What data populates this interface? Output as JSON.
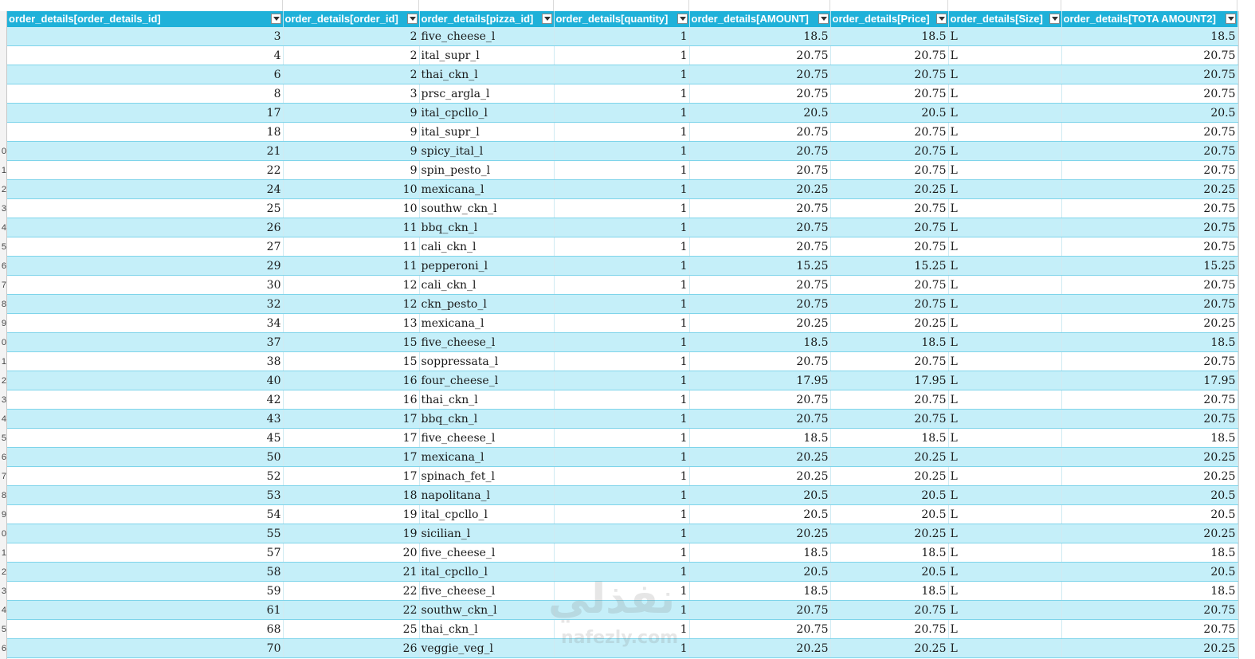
{
  "table": {
    "columns": [
      {
        "key": "order_details_id",
        "label": "order_details[order_details_id]",
        "align": "right"
      },
      {
        "key": "order_id",
        "label": "order_details[order_id]",
        "align": "right"
      },
      {
        "key": "pizza_id",
        "label": "order_details[pizza_id]",
        "align": "left"
      },
      {
        "key": "quantity",
        "label": "order_details[quantity]",
        "align": "right"
      },
      {
        "key": "amount",
        "label": "order_details[AMOUNT]",
        "align": "right"
      },
      {
        "key": "price",
        "label": "order_details[Price]",
        "align": "right"
      },
      {
        "key": "size",
        "label": "order_details[Size]",
        "align": "left"
      },
      {
        "key": "total_amount2",
        "label": "order_details[TOTA AMOUNT2]",
        "align": "right"
      }
    ],
    "rows": [
      [
        "3",
        "2",
        "five_cheese_l",
        "1",
        "18.5",
        "18.5",
        "L",
        "18.5"
      ],
      [
        "4",
        "2",
        "ital_supr_l",
        "1",
        "20.75",
        "20.75",
        "L",
        "20.75"
      ],
      [
        "6",
        "2",
        "thai_ckn_l",
        "1",
        "20.75",
        "20.75",
        "L",
        "20.75"
      ],
      [
        "8",
        "3",
        "prsc_argla_l",
        "1",
        "20.75",
        "20.75",
        "L",
        "20.75"
      ],
      [
        "17",
        "9",
        "ital_cpcllo_l",
        "1",
        "20.5",
        "20.5",
        "L",
        "20.5"
      ],
      [
        "18",
        "9",
        "ital_supr_l",
        "1",
        "20.75",
        "20.75",
        "L",
        "20.75"
      ],
      [
        "21",
        "9",
        "spicy_ital_l",
        "1",
        "20.75",
        "20.75",
        "L",
        "20.75"
      ],
      [
        "22",
        "9",
        "spin_pesto_l",
        "1",
        "20.75",
        "20.75",
        "L",
        "20.75"
      ],
      [
        "24",
        "10",
        "mexicana_l",
        "1",
        "20.25",
        "20.25",
        "L",
        "20.25"
      ],
      [
        "25",
        "10",
        "southw_ckn_l",
        "1",
        "20.75",
        "20.75",
        "L",
        "20.75"
      ],
      [
        "26",
        "11",
        "bbq_ckn_l",
        "1",
        "20.75",
        "20.75",
        "L",
        "20.75"
      ],
      [
        "27",
        "11",
        "cali_ckn_l",
        "1",
        "20.75",
        "20.75",
        "L",
        "20.75"
      ],
      [
        "29",
        "11",
        "pepperoni_l",
        "1",
        "15.25",
        "15.25",
        "L",
        "15.25"
      ],
      [
        "30",
        "12",
        "cali_ckn_l",
        "1",
        "20.75",
        "20.75",
        "L",
        "20.75"
      ],
      [
        "32",
        "12",
        "ckn_pesto_l",
        "1",
        "20.75",
        "20.75",
        "L",
        "20.75"
      ],
      [
        "34",
        "13",
        "mexicana_l",
        "1",
        "20.25",
        "20.25",
        "L",
        "20.25"
      ],
      [
        "37",
        "15",
        "five_cheese_l",
        "1",
        "18.5",
        "18.5",
        "L",
        "18.5"
      ],
      [
        "38",
        "15",
        "soppressata_l",
        "1",
        "20.75",
        "20.75",
        "L",
        "20.75"
      ],
      [
        "40",
        "16",
        "four_cheese_l",
        "1",
        "17.95",
        "17.95",
        "L",
        "17.95"
      ],
      [
        "42",
        "16",
        "thai_ckn_l",
        "1",
        "20.75",
        "20.75",
        "L",
        "20.75"
      ],
      [
        "43",
        "17",
        "bbq_ckn_l",
        "1",
        "20.75",
        "20.75",
        "L",
        "20.75"
      ],
      [
        "45",
        "17",
        "five_cheese_l",
        "1",
        "18.5",
        "18.5",
        "L",
        "18.5"
      ],
      [
        "50",
        "17",
        "mexicana_l",
        "1",
        "20.25",
        "20.25",
        "L",
        "20.25"
      ],
      [
        "52",
        "17",
        "spinach_fet_l",
        "1",
        "20.25",
        "20.25",
        "L",
        "20.25"
      ],
      [
        "53",
        "18",
        "napolitana_l",
        "1",
        "20.5",
        "20.5",
        "L",
        "20.5"
      ],
      [
        "54",
        "19",
        "ital_cpcllo_l",
        "1",
        "20.5",
        "20.5",
        "L",
        "20.5"
      ],
      [
        "55",
        "19",
        "sicilian_l",
        "1",
        "20.25",
        "20.25",
        "L",
        "20.25"
      ],
      [
        "57",
        "20",
        "five_cheese_l",
        "1",
        "18.5",
        "18.5",
        "L",
        "18.5"
      ],
      [
        "58",
        "21",
        "ital_cpcllo_l",
        "1",
        "20.5",
        "20.5",
        "L",
        "20.5"
      ],
      [
        "59",
        "22",
        "five_cheese_l",
        "1",
        "18.5",
        "18.5",
        "L",
        "18.5"
      ],
      [
        "61",
        "22",
        "southw_ckn_l",
        "1",
        "20.75",
        "20.75",
        "L",
        "20.75"
      ],
      [
        "68",
        "25",
        "thai_ckn_l",
        "1",
        "20.75",
        "20.75",
        "L",
        "20.75"
      ],
      [
        "70",
        "26",
        "veggie_veg_l",
        "1",
        "20.25",
        "20.25",
        "L",
        "20.25"
      ]
    ]
  },
  "row_numbers": [
    "",
    "",
    "",
    "",
    "",
    "",
    "0",
    "1",
    "2",
    "3",
    "4",
    "5",
    "6",
    "7",
    "8",
    "9",
    "0",
    "1",
    "2",
    "3",
    "4",
    "5",
    "6",
    "7",
    "8",
    "9",
    "0",
    "1",
    "2",
    "3",
    "4",
    "5",
    "6"
  ],
  "filter_icon": "dropdown-arrow-icon",
  "watermark": {
    "main": "نفذلي",
    "sub": "nafezly.com"
  },
  "colors": {
    "header_bg": "#1fb1d9",
    "band_bg": "#c5eff9",
    "row_border": "#7fd4ea"
  }
}
